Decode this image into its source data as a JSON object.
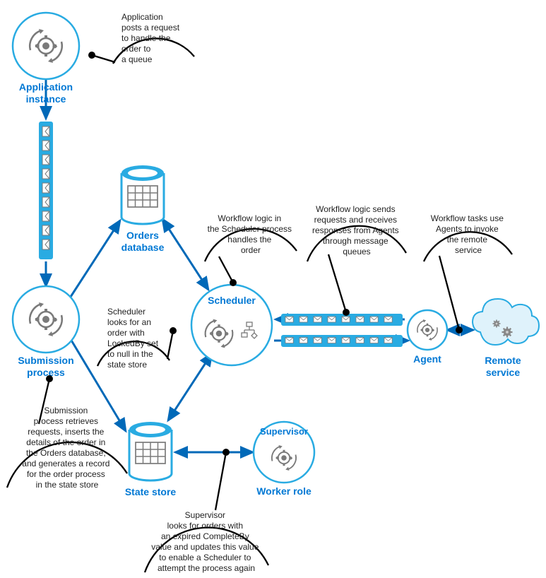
{
  "nodes": {
    "appInstance": {
      "label1": "Application",
      "label2": "instance"
    },
    "submission": {
      "label1": "Submission",
      "label2": "process"
    },
    "ordersDb": {
      "label1": "Orders",
      "label2": "database"
    },
    "stateStore": {
      "label": "State store"
    },
    "scheduler": {
      "label": "Scheduler"
    },
    "agent": {
      "label": "Agent"
    },
    "remoteService": {
      "label1": "Remote",
      "label2": "service"
    },
    "supervisor": {
      "label": "Supervisor",
      "sub": "Worker role"
    }
  },
  "callouts": {
    "app": {
      "l1": "Application",
      "l2": "posts a request",
      "l3": "to handle the",
      "l4": "order to",
      "l5": "a queue"
    },
    "submission": {
      "l1": "Submission",
      "l2": "process retrieves",
      "l3": "requests, inserts the",
      "l4": "details of the order in",
      "l5": "the Orders database,",
      "l6": "and generates a record",
      "l7": "for the order process",
      "l8": "in the state store"
    },
    "schedulerLookup": {
      "l1": "Scheduler",
      "l2": "looks for an",
      "l3": "order with",
      "l4": "LockedBy set",
      "l5": "to null in the",
      "l6": "state store"
    },
    "workflowLogic": {
      "l1": "Workflow logic in",
      "l2": "the Scheduler process",
      "l3": "handles the",
      "l4": "order"
    },
    "workflowQueues": {
      "l1": "Workflow logic sends",
      "l2": "requests and receives",
      "l3": "responses from Agents",
      "l4": "through message",
      "l5": "queues"
    },
    "workflowTasks": {
      "l1": "Workflow tasks use",
      "l2": "Agents to invoke",
      "l3": "the remote",
      "l4": "service"
    },
    "supervisor": {
      "l1": "Supervisor",
      "l2": "looks for orders with",
      "l3": "an expired CompleteBy",
      "l4": "value and updates this value",
      "l5": "to enable a Scheduler to",
      "l6": "attempt the process again"
    }
  }
}
